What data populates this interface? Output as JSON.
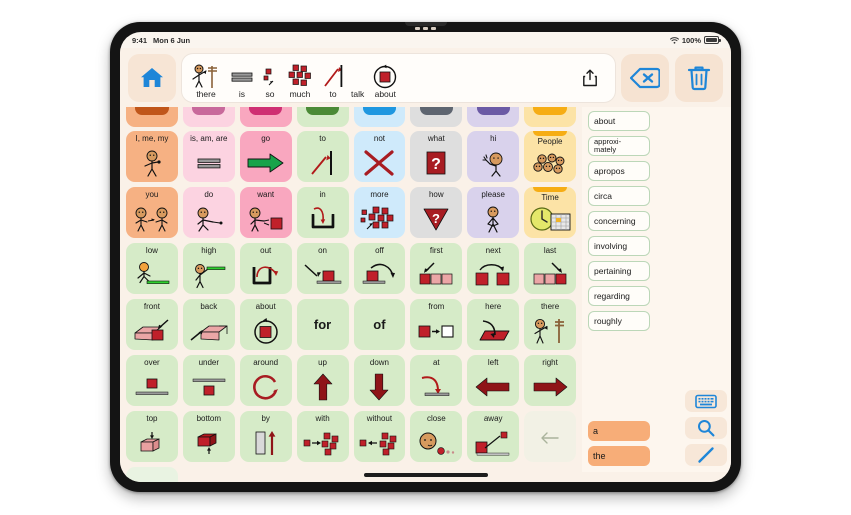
{
  "status_bar": {
    "time": "9:41",
    "date": "Mon 6 Jun",
    "battery_pct": "100%",
    "wifi_icon": "wifi-icon",
    "battery_icon": "battery-icon"
  },
  "toolbar": {
    "home_icon": "home-icon",
    "share_icon": "share-icon",
    "backspace_icon": "backspace-icon",
    "trash_icon": "trash-icon",
    "sentence": [
      {
        "label": "there",
        "icon": "person-pointing-signpost-icon"
      },
      {
        "label": "is",
        "icon": "equals-icon"
      },
      {
        "label": "so",
        "icon": "few-blocks-icon"
      },
      {
        "label": "much",
        "icon": "many-blocks-icon"
      },
      {
        "label": "to",
        "icon": "arrow-to-line-icon"
      },
      {
        "label": "talk",
        "icon": "talk-icon"
      },
      {
        "label": "about",
        "icon": "circle-arrow-block-icon"
      }
    ]
  },
  "colors": {
    "orange": "#f6b183",
    "orange_cap": "#c0561a",
    "pink_light": "#fcd3e1",
    "pink_light_cap": "#c8699b",
    "pink": "#f9a7bf",
    "pink_cap": "#cf2f72",
    "green": "#d6ebc8",
    "green_cap": "#4b8a36",
    "blue": "#cfeafb",
    "blue_cap": "#1f97e0",
    "gray": "#dedede",
    "gray_cap": "#5e6570",
    "purple": "#d9d2ec",
    "purple_cap": "#6b5aa5",
    "yellow": "#fce3a6",
    "yellow_cap": "#f6ad14",
    "accent_blue": "#1f86d8",
    "sidebar_bg": "#fdf6ee",
    "app_bg": "#faf1e8"
  },
  "peek_tabs": [
    "orange",
    "pink_light",
    "pink",
    "green",
    "blue",
    "gray",
    "purple",
    "yellow"
  ],
  "grid": {
    "rows": [
      [
        {
          "label": "I, me, my",
          "icon": "person-self-icon",
          "color": "orange",
          "cap": false
        },
        {
          "label": "is, am, are",
          "icon": "equals-icon",
          "color": "pink_light",
          "cap": false
        },
        {
          "label": "go",
          "icon": "green-arrow-right-icon",
          "color": "pink",
          "cap": false
        },
        {
          "label": "to",
          "icon": "arrow-to-line-icon",
          "color": "green",
          "cap": false
        },
        {
          "label": "not",
          "icon": "red-x-icon",
          "color": "blue",
          "cap": false
        },
        {
          "label": "what",
          "icon": "question-square-icon",
          "color": "gray",
          "cap": false
        },
        {
          "label": "hi",
          "icon": "person-waving-icon",
          "color": "purple",
          "cap": false
        },
        {
          "label": "People",
          "icon": "group-people-icon",
          "color": "yellow",
          "cap": true
        }
      ],
      [
        {
          "label": "you",
          "icon": "two-people-icon",
          "color": "orange",
          "cap": false
        },
        {
          "label": "do",
          "icon": "person-doing-icon",
          "color": "pink_light",
          "cap": false
        },
        {
          "label": "want",
          "icon": "person-reaching-block-icon",
          "color": "pink",
          "cap": false
        },
        {
          "label": "in",
          "icon": "arrow-into-container-icon",
          "color": "green",
          "cap": false
        },
        {
          "label": "more",
          "icon": "many-blocks-icon",
          "color": "blue",
          "cap": false
        },
        {
          "label": "how",
          "icon": "question-triangle-icon",
          "color": "gray",
          "cap": false
        },
        {
          "label": "please",
          "icon": "person-pleading-icon",
          "color": "purple",
          "cap": false
        },
        {
          "label": "Time",
          "icon": "clock-calendar-icon",
          "color": "yellow",
          "cap": true
        }
      ],
      [
        {
          "label": "low",
          "icon": "person-crouching-icon",
          "color": "green",
          "cap": false
        },
        {
          "label": "high",
          "icon": "person-reaching-up-icon",
          "color": "green",
          "cap": false
        },
        {
          "label": "out",
          "icon": "arrow-out-container-icon",
          "color": "green",
          "cap": false
        },
        {
          "label": "on",
          "icon": "block-onto-line-icon",
          "color": "green",
          "cap": false
        },
        {
          "label": "off",
          "icon": "block-off-line-icon",
          "color": "green",
          "cap": false
        },
        {
          "label": "first",
          "icon": "first-block-icon",
          "color": "green",
          "cap": false
        },
        {
          "label": "next",
          "icon": "next-block-icon",
          "color": "green",
          "cap": false
        },
        {
          "label": "last",
          "icon": "last-block-icon",
          "color": "green",
          "cap": false
        }
      ],
      [
        {
          "label": "front",
          "icon": "front-of-box-icon",
          "color": "green",
          "cap": false
        },
        {
          "label": "back",
          "icon": "back-of-box-icon",
          "color": "green",
          "cap": false
        },
        {
          "label": "about",
          "icon": "circle-arrow-block-icon",
          "color": "green",
          "cap": false
        },
        {
          "label": "for",
          "icon": "text-only",
          "color": "green",
          "cap": false,
          "text_only": true
        },
        {
          "label": "of",
          "icon": "text-only",
          "color": "green",
          "cap": false,
          "text_only": true
        },
        {
          "label": "from",
          "icon": "block-to-empty-icon",
          "color": "green",
          "cap": false
        },
        {
          "label": "here",
          "icon": "hand-on-surface-icon",
          "color": "green",
          "cap": false
        },
        {
          "label": "there",
          "icon": "person-pointing-signpost-icon",
          "color": "green",
          "cap": false
        }
      ],
      [
        {
          "label": "over",
          "icon": "block-over-line-icon",
          "color": "green",
          "cap": false
        },
        {
          "label": "under",
          "icon": "block-under-line-icon",
          "color": "green",
          "cap": false
        },
        {
          "label": "around",
          "icon": "circular-arrow-icon",
          "color": "green",
          "cap": false
        },
        {
          "label": "up",
          "icon": "arrow-up-icon",
          "color": "green",
          "cap": false
        },
        {
          "label": "down",
          "icon": "arrow-down-icon",
          "color": "green",
          "cap": false
        },
        {
          "label": "at",
          "icon": "arrow-at-line-icon",
          "color": "green",
          "cap": false
        },
        {
          "label": "left",
          "icon": "arrow-left-icon",
          "color": "green",
          "cap": false
        },
        {
          "label": "right",
          "icon": "arrow-right-icon",
          "color": "green",
          "cap": false
        }
      ],
      [
        {
          "label": "top",
          "icon": "top-of-cube-icon",
          "color": "green",
          "cap": false
        },
        {
          "label": "bottom",
          "icon": "bottom-of-cube-icon",
          "color": "green",
          "cap": false
        },
        {
          "label": "by",
          "icon": "bar-beside-arrow-icon",
          "color": "green",
          "cap": false
        },
        {
          "label": "with",
          "icon": "blocks-together-icon",
          "color": "green",
          "cap": false
        },
        {
          "label": "without",
          "icon": "blocks-apart-icon",
          "color": "green",
          "cap": false
        },
        {
          "label": "close",
          "icon": "person-close-dots-icon",
          "color": "green",
          "cap": false
        },
        {
          "label": "away",
          "icon": "block-away-icon",
          "color": "green",
          "cap": false
        }
      ]
    ],
    "nav": {
      "prev_icon": "arrow-left-nav-icon",
      "next_icon": "arrow-right-nav-icon"
    }
  },
  "sidebar": {
    "predictions": [
      "about",
      "approximately",
      "apropos",
      "circa",
      "concerning",
      "involving",
      "pertaining",
      "regarding",
      "roughly"
    ],
    "quick_words": [
      "a",
      "the"
    ],
    "tools": [
      {
        "icon": "keyboard-icon",
        "name": "keyboard-button"
      },
      {
        "icon": "search-icon",
        "name": "search-button"
      },
      {
        "icon": "pencil-icon",
        "name": "edit-button"
      }
    ]
  }
}
